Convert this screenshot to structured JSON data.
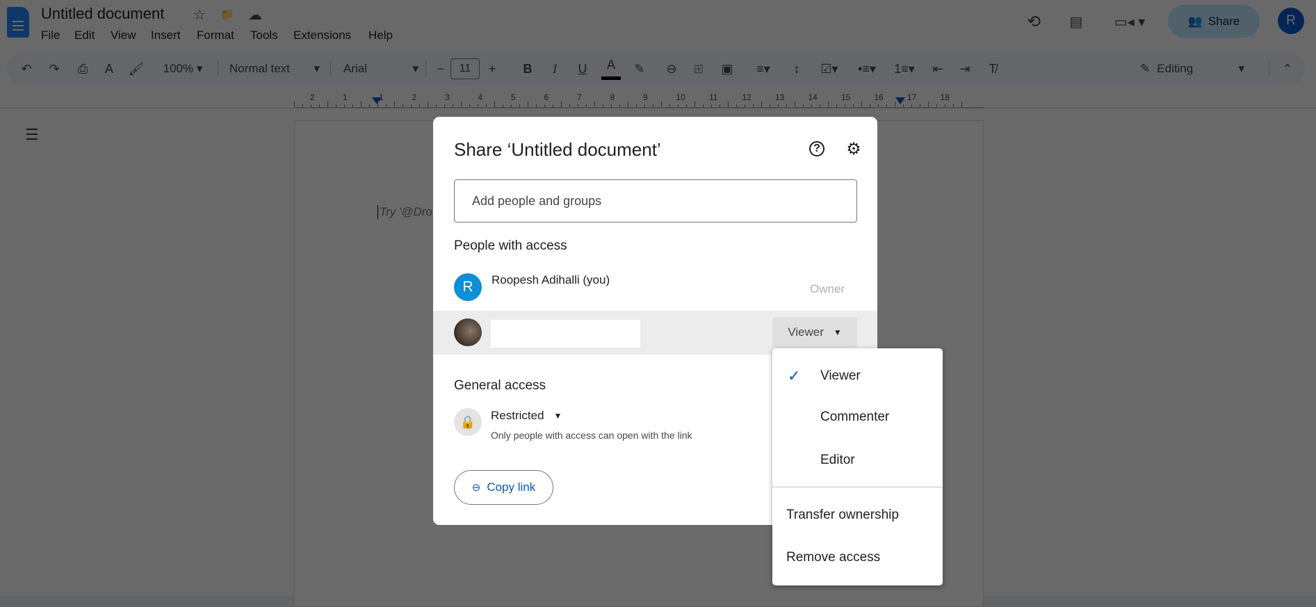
{
  "app": {
    "title": "Untitled document",
    "menus": [
      "File",
      "Edit",
      "View",
      "Insert",
      "Format",
      "Tools",
      "Extensions",
      "Help"
    ],
    "share_label": "Share",
    "avatar_initial": "R"
  },
  "toolbar": {
    "zoom": "100%",
    "style": "Normal text",
    "font": "Arial",
    "font_size": "11",
    "mode": "Editing"
  },
  "ruler": [
    "2",
    "1",
    "1",
    "2",
    "3",
    "4",
    "5",
    "6",
    "7",
    "8",
    "9",
    "10",
    "11",
    "12",
    "13",
    "14",
    "15",
    "16",
    "17",
    "18"
  ],
  "document": {
    "placeholder": "Try '@Dro"
  },
  "dialog": {
    "title": "Share ‘Untitled document’",
    "add_placeholder": "Add people and groups",
    "people_heading": "People with access",
    "people": [
      {
        "initial": "R",
        "name": "Roopesh Adihalli (you)",
        "role": "Owner"
      },
      {
        "role": "Viewer"
      }
    ],
    "general_heading": "General access",
    "access_level": "Restricted",
    "access_desc": "Only people with access can open with the link",
    "copy_link": "Copy link"
  },
  "role_menu": {
    "items": [
      "Viewer",
      "Commenter",
      "Editor"
    ],
    "selected": "Viewer",
    "actions": [
      "Transfer ownership",
      "Remove access"
    ]
  },
  "colors": {
    "accent": "#0b57d0",
    "share_bg": "#c2e7ff",
    "avatar": "#0b8fd6"
  }
}
